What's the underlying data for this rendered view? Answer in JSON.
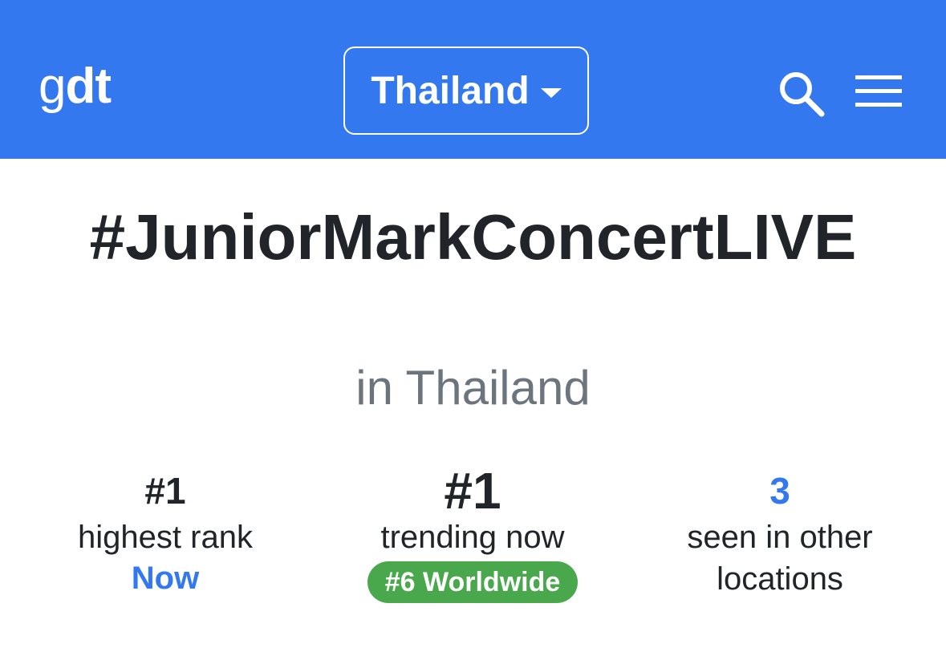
{
  "navbar": {
    "logo_light": "g",
    "logo_bold": "dt",
    "country_label": "Thailand",
    "background_color": "#3478f0"
  },
  "trend": {
    "hashtag": "#JuniorMarkConcertLIVE",
    "location_text": "in Thailand"
  },
  "stats": {
    "highest_rank": {
      "value": "#1",
      "label": "highest rank",
      "sub_label": "Now"
    },
    "trending_now": {
      "value": "#1",
      "label": "trending now",
      "badge": "#6 Worldwide",
      "badge_color": "#4aa84c"
    },
    "other_locations": {
      "value": "3",
      "label": "seen in other locations"
    }
  },
  "icons": {
    "search": "search-icon",
    "menu": "hamburger-menu-icon",
    "dropdown": "caret-down-icon"
  }
}
